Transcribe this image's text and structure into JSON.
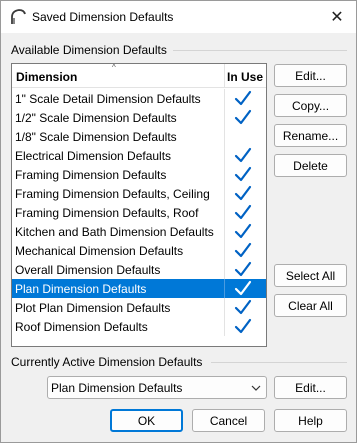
{
  "window": {
    "title": "Saved Dimension Defaults",
    "close_glyph": "✕"
  },
  "available_group": {
    "label": "Available Dimension Defaults"
  },
  "list": {
    "header_dimension": "Dimension",
    "header_in_use": "In Use",
    "sort_glyph": "^",
    "selected_index": 10,
    "accent_color": "#0078d7",
    "check_color": "#0062c4",
    "rows": [
      {
        "name": "1\" Scale Detail Dimension Defaults",
        "in_use": true
      },
      {
        "name": "1/2\" Scale Dimension Defaults",
        "in_use": true
      },
      {
        "name": "1/8\" Scale Dimension Defaults",
        "in_use": false
      },
      {
        "name": "Electrical Dimension Defaults",
        "in_use": true
      },
      {
        "name": "Framing Dimension Defaults",
        "in_use": true
      },
      {
        "name": "Framing Dimension Defaults, Ceiling",
        "in_use": true
      },
      {
        "name": "Framing Dimension Defaults, Roof",
        "in_use": true
      },
      {
        "name": "Kitchen and Bath Dimension Defaults",
        "in_use": true
      },
      {
        "name": "Mechanical Dimension Defaults",
        "in_use": true
      },
      {
        "name": "Overall Dimension Defaults",
        "in_use": true
      },
      {
        "name": "Plan Dimension Defaults",
        "in_use": true
      },
      {
        "name": "Plot Plan Dimension Defaults",
        "in_use": true
      },
      {
        "name": "Roof Dimension Defaults",
        "in_use": true
      }
    ]
  },
  "side_buttons": {
    "edit": "Edit...",
    "copy": "Copy...",
    "rename": "Rename...",
    "delete": "Delete",
    "select_all": "Select All",
    "clear_all": "Clear All"
  },
  "active_group": {
    "label": "Currently Active Dimension Defaults",
    "combo_value": "Plan Dimension Defaults",
    "edit": "Edit..."
  },
  "footer": {
    "ok": "OK",
    "cancel": "Cancel",
    "help": "Help"
  }
}
